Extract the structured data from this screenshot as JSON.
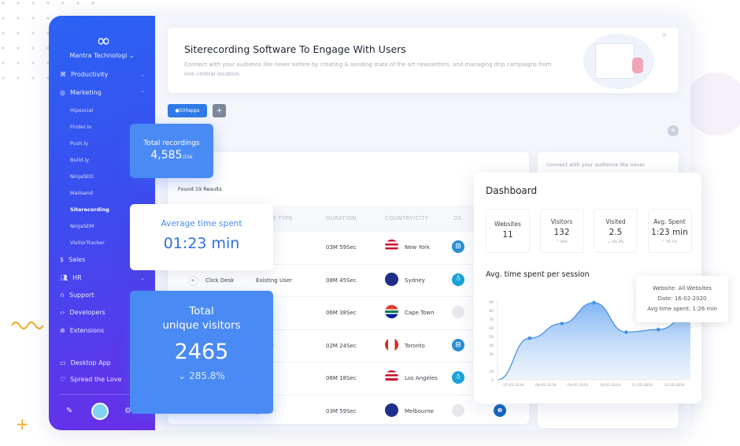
{
  "colors": {
    "sidebar_start": "#2a63f2",
    "sidebar_end": "#6a2ee8",
    "accent": "#4a8af4",
    "up": "#2fb344",
    "down": "#d63939"
  },
  "sidebar": {
    "logo": "∞",
    "org": "Mantra Technologi",
    "org_icon": "chevron-down-icon",
    "items": [
      {
        "label": "Productivity",
        "icon": "command-icon"
      },
      {
        "label": "Marketing",
        "icon": "aperture-icon"
      }
    ],
    "subitems": [
      "Hipsocial",
      "Finder.io",
      "Push.ly",
      "Build.ly",
      "NinjaSEO",
      "Mailsend",
      "Siterecording",
      "NinjaSEM",
      "VisitorTracker"
    ],
    "active": "Siterecording",
    "items2": [
      {
        "label": "Sales",
        "icon": "dollar-icon"
      },
      {
        "label": "HR",
        "icon": "users-icon"
      },
      {
        "label": "Support",
        "icon": "headphones-icon"
      },
      {
        "label": "Developers",
        "icon": "code-icon"
      },
      {
        "label": "Extensions",
        "icon": "chrome-icon"
      }
    ],
    "bottom": [
      {
        "label": "Desktop App",
        "icon": "monitor-icon"
      },
      {
        "label": "Spread the Love",
        "icon": "heart-icon"
      }
    ]
  },
  "banner": {
    "title": "Siterecording Software To Engage With Users",
    "description": "Connect with your audience like never before by creating & sending state of the art newsletters, and managing drip campaigns from one central location.",
    "close": "×"
  },
  "workspace": {
    "tag": "500apps",
    "add": "+"
  },
  "side_card": {
    "text": "Connect with your audience like never"
  },
  "table": {
    "results": "Found 19 Results",
    "headers": [
      "OR TYPE",
      "DURATION",
      "COUNTRY/CITY",
      "OS"
    ],
    "rows": [
      {
        "name": "",
        "type": "ser",
        "duration": "03M 59Sec",
        "city": "New York",
        "flag": "us",
        "os": "windows"
      },
      {
        "name": "Click Desk",
        "type": "Existing User",
        "duration": "08M 45Sec",
        "city": "Sydney",
        "flag": "au",
        "os": "linux"
      },
      {
        "name": "",
        "type": "ser",
        "duration": "06M 38Sec",
        "city": "Cape Town",
        "flag": "za",
        "os": "apple"
      },
      {
        "name": "",
        "type": "g User",
        "duration": "02M 24Sec",
        "city": "Toronto",
        "flag": "ca",
        "os": "windows"
      },
      {
        "name": "",
        "type": "ser",
        "duration": "06M 18Sec",
        "city": "Los Angeles",
        "flag": "us",
        "os": "linux"
      },
      {
        "name": "",
        "type": "g User",
        "duration": "03M 59Sec",
        "city": "Melbourne",
        "flag": "au",
        "os": "apple",
        "browser": "ie"
      }
    ]
  },
  "recordings": {
    "label": "Total recordings",
    "value": "4,585",
    "limit": "/15k"
  },
  "avg_time": {
    "label": "Average time spent",
    "value": "01:23 min"
  },
  "visitors": {
    "label1": "Total",
    "label2": "unique visitors",
    "value": "2465",
    "change": "285.8%"
  },
  "dashboard": {
    "title": "Dashboard",
    "stats": [
      {
        "label": "Websites",
        "value": "11",
        "delta": ""
      },
      {
        "label": "Visitors",
        "value": "132",
        "delta": "56%",
        "dir": "up"
      },
      {
        "label": "Visited",
        "value": "2.5",
        "delta": "-81.2%",
        "dir": "down"
      },
      {
        "label": "Avg. Spent",
        "value": "1:23 min",
        "delta": "59.1%",
        "dir": "up"
      }
    ],
    "chart_title": "Avg. time spent per session"
  },
  "tooltip": {
    "line1": "Website: All Websites",
    "line2": "Date: 16-02-2020",
    "line3": "Avg time spent: 1:26 min"
  },
  "chart_data": {
    "type": "area",
    "title": "Avg. time spent per session",
    "categories": [
      "07-05-2019",
      "08-05-2019",
      "09-05-2019",
      "10-05-2019",
      "11-05-2019",
      "12-05-2019"
    ],
    "points": [
      0,
      48,
      65,
      89,
      55,
      58,
      75
    ],
    "yticks": [
      0,
      10,
      30,
      40,
      50,
      60,
      70,
      80,
      90
    ],
    "ylim": [
      0,
      90
    ],
    "grid": false
  }
}
